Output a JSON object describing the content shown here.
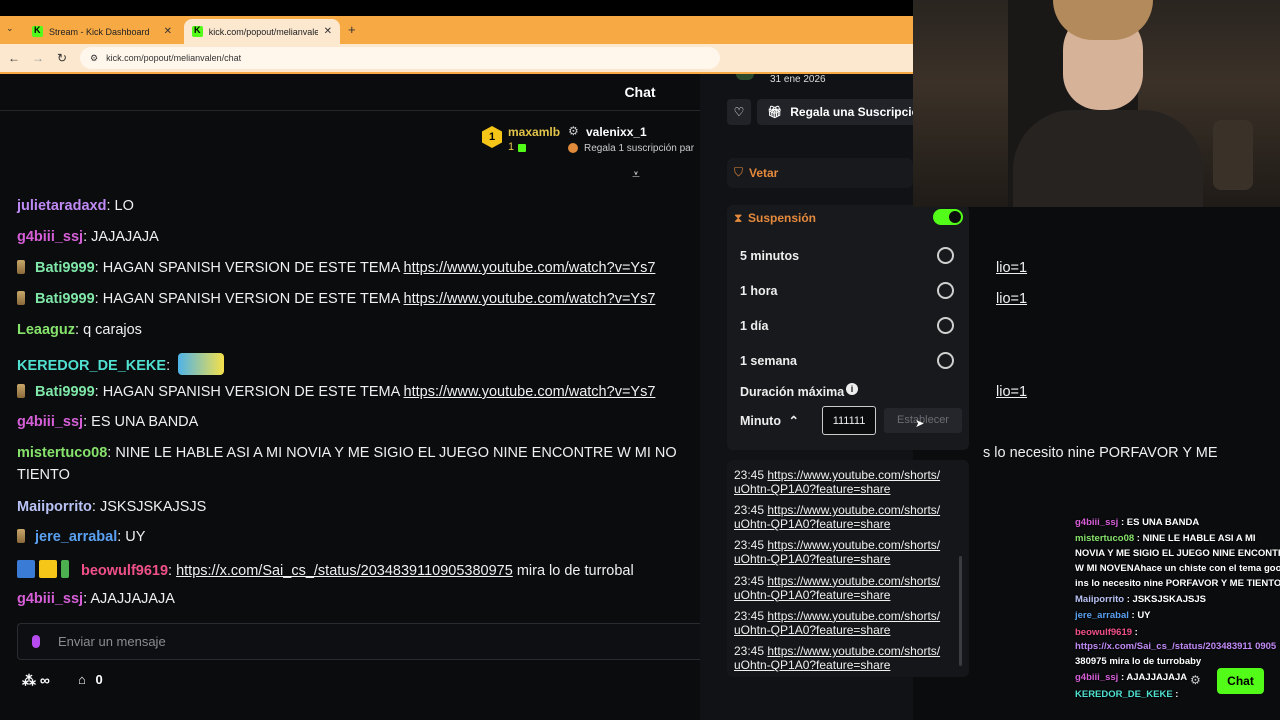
{
  "browser": {
    "tabs": [
      {
        "label": "Stream - Kick Dashboard",
        "close": "✕"
      },
      {
        "label": "kick.com/popout/melianvalen/c",
        "close": "✕"
      }
    ],
    "new_tab": "+",
    "url": "kick.com/popout/melianvalen/chat"
  },
  "chat": {
    "title": "Chat",
    "pinned": {
      "user1": "maxamlb",
      "user1_count": "1",
      "user2": "valenixx_1",
      "gift_text": "Regala 1 suscripción par",
      "badge": "1"
    },
    "messages": [
      {
        "user": "julietaradaxd",
        "color": "#c08af5",
        "sep": ": ",
        "text": "LO"
      },
      {
        "user": "g4biii_ssj",
        "color": "#d65fd8",
        "sep": ": ",
        "text": "JAJAJAJA"
      },
      {
        "user": "Bati9999",
        "color": "#7fe7a8",
        "sep": ": ",
        "text": "HAGAN SPANISH VERSION DE ESTE TEMA ",
        "link": "https://www.youtube.com/watch?v=Ys7",
        "tail": "lio=1"
      },
      {
        "user": "Bati9999",
        "color": "#7fe7a8",
        "sep": ": ",
        "text": "HAGAN SPANISH VERSION DE ESTE TEMA ",
        "link": "https://www.youtube.com/watch?v=Ys7",
        "tail": "lio=1"
      },
      {
        "user": "Leaaguz",
        "color": "#86e36b",
        "sep": ": ",
        "text": "q carajos"
      },
      {
        "user": "KEREDOR_DE_KEKE",
        "color": "#4fe0d0",
        "sep": ": ",
        "text": ""
      },
      {
        "user": "Bati9999",
        "color": "#7fe7a8",
        "sep": ": ",
        "text": "HAGAN SPANISH VERSION DE ESTE TEMA ",
        "link": "https://www.youtube.com/watch?v=Ys7",
        "tail": "lio=1"
      },
      {
        "user": "g4biii_ssj",
        "color": "#d65fd8",
        "sep": ": ",
        "text": "ES UNA BANDA"
      },
      {
        "user": "mistertuco08",
        "color": "#86e36b",
        "sep": ": ",
        "text": "NINE LE HABLE ASI A MI NOVIA Y ME SIGIO EL JUEGO NINE ENCONTRE W MI NO",
        "tail": "s lo necesito nine PORFAVOR Y ME",
        "line2": "TIENTO"
      },
      {
        "user": "Maiiporrito",
        "color": "#b9c2f5",
        "sep": ": ",
        "text": "JSKSJSKAJSJS"
      },
      {
        "user": "jere_arrabal",
        "color": "#5aa0f0",
        "sep": ": ",
        "text": "UY"
      },
      {
        "user": "beowulf9619",
        "color": "#f0508a",
        "sep": ": ",
        "link": "https://x.com/Sai_cs_/status/2034839110905380975",
        "text": " mira lo de turrobal"
      },
      {
        "user": "g4biii_ssj",
        "color": "#d65fd8",
        "sep": ": ",
        "text": "AJAJJAJAJA"
      }
    ],
    "input_placeholder": "Enviar un mensaje",
    "footer": {
      "infinity": "∞",
      "store_count": "0"
    }
  },
  "panel": {
    "date": "31 ene 2026",
    "gift_sub": "Regala una Suscripción",
    "ban_label": "Vetar",
    "timeout_label": "Suspensión",
    "options": [
      "5 minutos",
      "1 hora",
      "1 día",
      "1 semana"
    ],
    "max_label": "Duración máxima",
    "unit": "Minuto",
    "value": "111111",
    "set_button": "Establecer",
    "log": [
      {
        "time": "23:45",
        "link1": "https://www.youtube.com/shorts/",
        "link2": "uOhtn-QP1A0?feature=share"
      },
      {
        "time": "23:45",
        "link1": "https://www.youtube.com/shorts/",
        "link2": "uOhtn-QP1A0?feature=share"
      },
      {
        "time": "23:45",
        "link1": "https://www.youtube.com/shorts/",
        "link2": "uOhtn-QP1A0?feature=share"
      },
      {
        "time": "23:45",
        "link1": "https://www.youtube.com/shorts/",
        "link2": "uOhtn-QP1A0?feature=share"
      },
      {
        "time": "23:45",
        "link1": "https://www.youtube.com/shorts/",
        "link2": "uOhtn-QP1A0?feature=share"
      },
      {
        "time": "23:45",
        "link1": "https://www.youtube.com/shorts/",
        "link2": "uOhtn-QP1A0?feature=share"
      }
    ]
  },
  "overlay": {
    "lines": [
      {
        "user": "g4biii_ssj",
        "color": "#d65fd8",
        "text": " : ES UNA BANDA"
      },
      {
        "user": "mistertuco08",
        "color": "#86e36b",
        "text": " : NINE LE HABLE ASI A MI"
      },
      {
        "user": "",
        "color": "#fff",
        "text": "NOVIA Y ME SIGIO EL JUEGO NINE ENCONTRE"
      },
      {
        "user": "",
        "color": "#fff",
        "text": "W MI NOVENAhace un chiste con el tema good"
      },
      {
        "user": "",
        "color": "#fff",
        "text": "ins lo necesito nine PORFAVOR Y ME TIENTO"
      },
      {
        "user": "Maiiporrito",
        "color": "#b9c2f5",
        "text": " : JSKSJSKAJSJS"
      },
      {
        "user": "jere_arrabal",
        "color": "#5aa0f0",
        "text": " : UY"
      },
      {
        "user": "beowulf9619",
        "color": "#f0508a",
        "text": " :"
      },
      {
        "user": "",
        "color": "#c08af5",
        "text": "https://x.com/Sai_cs_/status/203483911 0905"
      },
      {
        "user": "",
        "color": "#fff",
        "text": "380975 mira lo de turrobaby"
      },
      {
        "user": "g4biii_ssj",
        "color": "#d65fd8",
        "text": " : AJAJJAJAJA"
      },
      {
        "user": "KEREDOR_DE_KEKE",
        "color": "#4fe0d0",
        "text": " :"
      }
    ],
    "chat_button": "Chat"
  },
  "colors": {
    "kick_green": "#53fc18",
    "tab_orange": "#f7a944"
  }
}
